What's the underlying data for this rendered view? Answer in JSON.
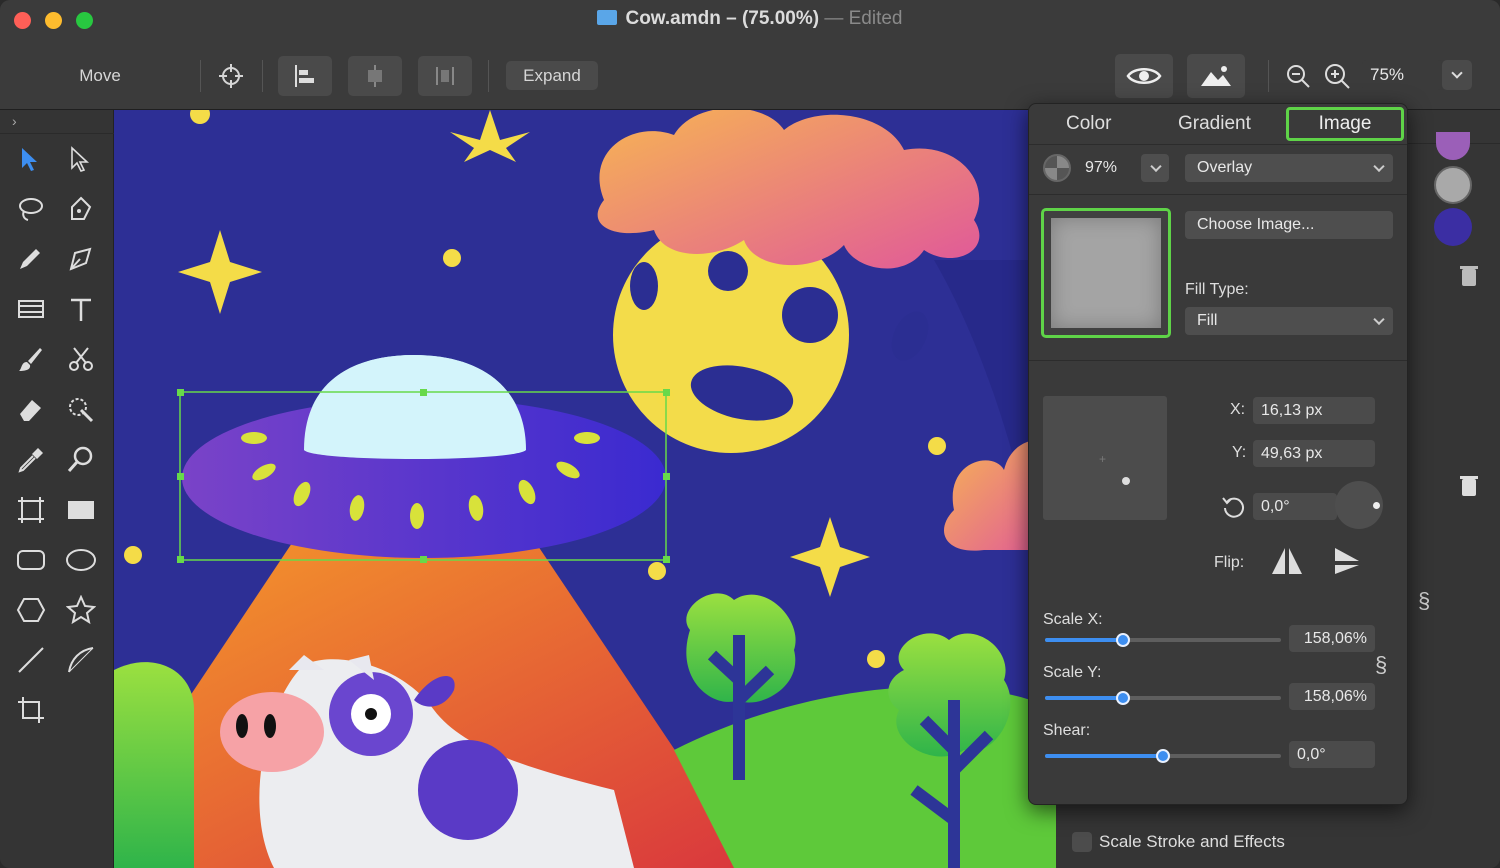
{
  "window": {
    "title": "Cow.amdn – (75.00%)",
    "status": "— Edited"
  },
  "toolbar": {
    "move_label": "Move",
    "expand_label": "Expand",
    "zoom_value": "75%"
  },
  "icons": {
    "target": "target-icon",
    "align": "align-icon",
    "eye": "eye-icon",
    "image": "image-icon",
    "zoom_out": "zoom-out-icon",
    "zoom_in": "zoom-in-icon"
  },
  "tools": [
    "select-arrow",
    "direct-select",
    "lasso",
    "pen",
    "pencil",
    "bezigon",
    "text-frame",
    "text",
    "brush",
    "scissors",
    "eraser",
    "magic-wand",
    "eyedropper",
    "magnifier",
    "artboard",
    "rectangle",
    "rounded-rect",
    "ellipse",
    "polygon",
    "star",
    "line",
    "arc",
    "crop"
  ],
  "fill_popover": {
    "tabs": [
      "Color",
      "Gradient",
      "Image"
    ],
    "active_tab": "Image",
    "opacity": "97%",
    "blend_mode": "Overlay",
    "choose_image_label": "Choose Image...",
    "fill_type_label": "Fill Type:",
    "fill_type_value": "Fill",
    "x_label": "X:",
    "x_value": "16,13 px",
    "y_label": "Y:",
    "y_value": "49,63 px",
    "rotation_value": "0,0°",
    "flip_label": "Flip:",
    "scale_x_label": "Scale X:",
    "scale_x_value": "158,06%",
    "scale_x_pos": 0.33,
    "scale_y_label": "Scale Y:",
    "scale_y_value": "158,06%",
    "scale_y_pos": 0.33,
    "shear_label": "Shear:",
    "shear_value": "0,0°",
    "shear_pos": 0.5
  },
  "right_panel": {
    "scale_stroke_label": "Scale Stroke and Effects"
  },
  "colors": {
    "accent": "#3d8ef0",
    "selection": "#67d94a",
    "canvas_bg": "#2b2c8f"
  }
}
